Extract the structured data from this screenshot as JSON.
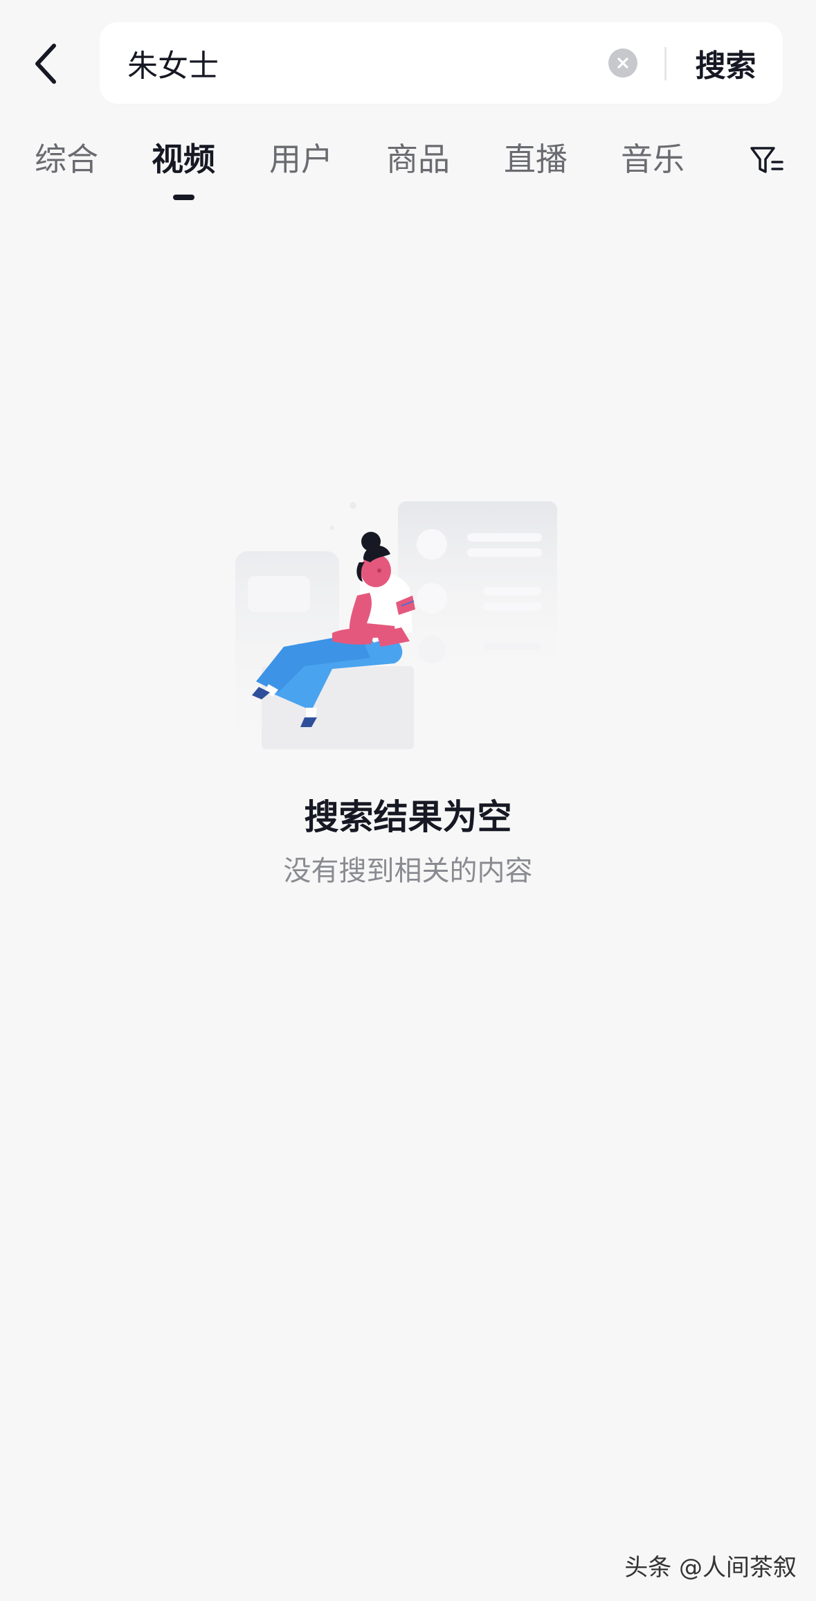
{
  "header": {
    "back_icon": "chevron-left-icon",
    "search": {
      "value": "朱女士",
      "placeholder": "",
      "clear_icon": "clear-circle-icon",
      "submit_label": "搜索"
    }
  },
  "tabs": {
    "items": [
      {
        "label": "综合",
        "active": false
      },
      {
        "label": "视频",
        "active": true
      },
      {
        "label": "用户",
        "active": false
      },
      {
        "label": "商品",
        "active": false
      },
      {
        "label": "直播",
        "active": false
      },
      {
        "label": "音乐",
        "active": false
      }
    ],
    "filter_icon": "filter-icon"
  },
  "empty_state": {
    "illustration": "person-sitting-empty-illustration",
    "title": "搜索结果为空",
    "subtitle": "没有搜到相关的内容"
  },
  "watermark": {
    "text": "头条 @人间茶叙"
  },
  "colors": {
    "background": "#f7f7f7",
    "primary_text": "#161823",
    "secondary_text": "#8a8b91",
    "tab_inactive": "#6a6b70",
    "illustration_pink": "#e5587d",
    "illustration_blue": "#4a9ef0"
  }
}
